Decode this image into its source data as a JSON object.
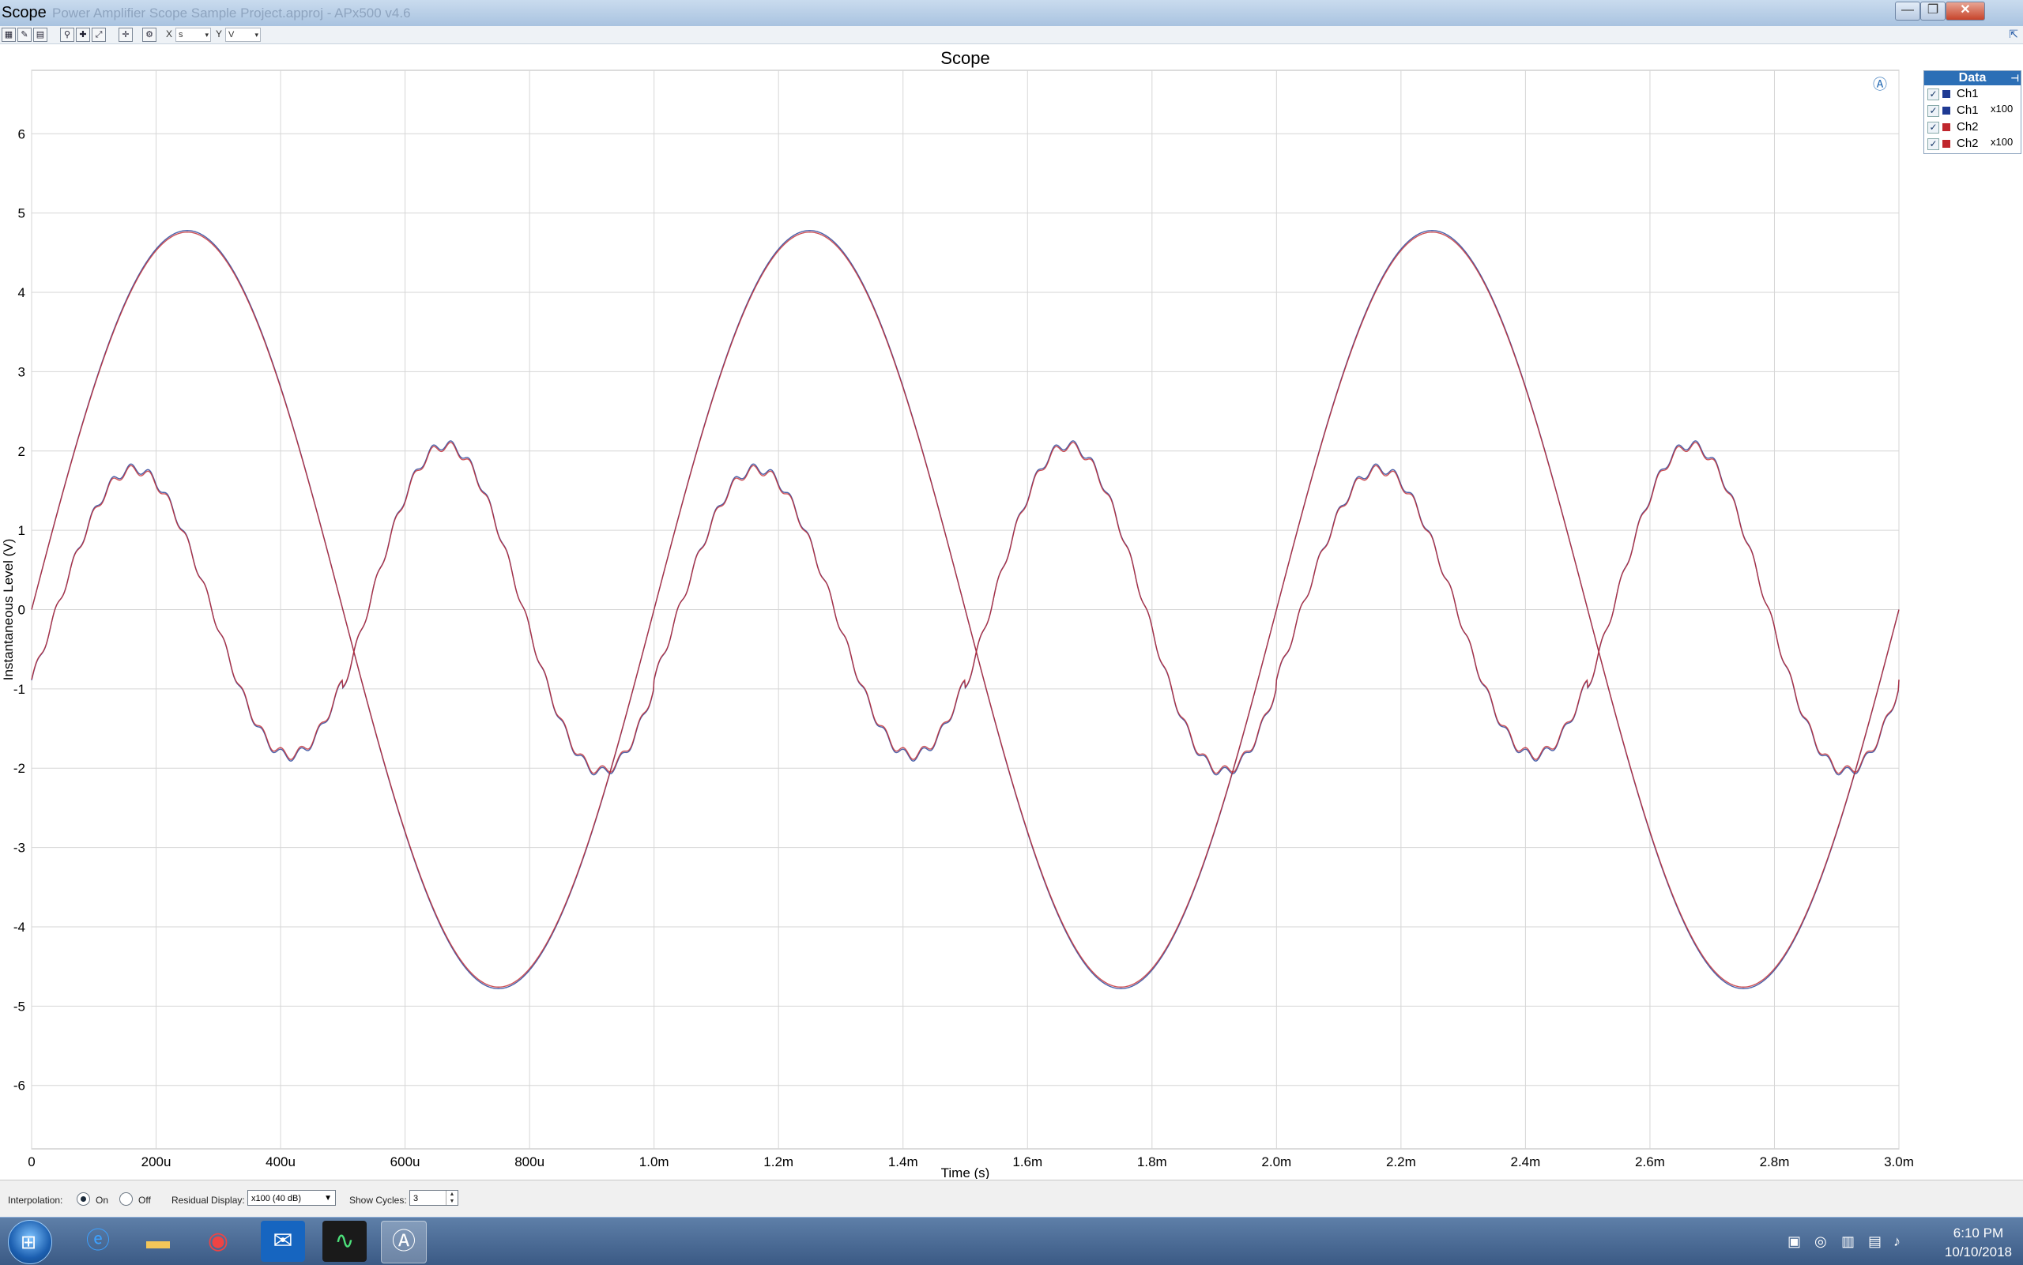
{
  "window": {
    "title": "Scope",
    "app_title": "Power Amplifier Scope Sample Project.approj - APx500 v4.6",
    "min": "—",
    "max": "❐",
    "close": "✕"
  },
  "toolbar": {
    "x_label": "X",
    "x_unit": "s",
    "y_label": "Y",
    "y_unit": "V"
  },
  "chart_data": {
    "type": "line",
    "title": "Scope",
    "xlabel": "Time (s)",
    "ylabel": "Instantaneous Level (V)",
    "xlim": [
      0,
      0.003
    ],
    "ylim": [
      -6.8,
      6.8
    ],
    "xticks": [
      0,
      0.0002,
      0.0004,
      0.0006,
      0.0008,
      0.001,
      0.0012,
      0.0014,
      0.0016,
      0.0018,
      0.002,
      0.0022,
      0.0024,
      0.0026,
      0.0028,
      0.003
    ],
    "xtick_labels": [
      "0",
      "200u",
      "400u",
      "600u",
      "800u",
      "1.0m",
      "1.2m",
      "1.4m",
      "1.6m",
      "1.8m",
      "2.0m",
      "2.2m",
      "2.4m",
      "2.6m",
      "2.8m",
      "3.0m"
    ],
    "yticks": [
      -6,
      -5,
      -4,
      -3,
      -2,
      -1,
      0,
      1,
      2,
      3,
      4,
      5,
      6
    ],
    "ytick_labels": [
      "-6",
      "-5",
      "-4",
      "-3",
      "-2",
      "-1",
      "0",
      "1",
      "2",
      "3",
      "4",
      "5",
      "6"
    ],
    "grid": true,
    "legend_position": "right",
    "series": [
      {
        "name": "Ch1",
        "kind": "sine",
        "amplitude": 4.78,
        "frequency_hz": 1000,
        "color": "#1f3a93"
      },
      {
        "name": "Ch1",
        "suffix": "x100",
        "kind": "residual",
        "peaks_pos": [
          1.78,
          2.08
        ],
        "peaks_neg": [
          -1.85,
          -2.05
        ],
        "frequency_hz": 2000,
        "ripple_hz": 33000,
        "color": "#1f3a93"
      },
      {
        "name": "Ch2",
        "kind": "sine",
        "amplitude": 4.76,
        "frequency_hz": 1000,
        "color": "#c0262d"
      },
      {
        "name": "Ch2",
        "suffix": "x100",
        "kind": "residual",
        "peaks_pos": [
          1.76,
          2.06
        ],
        "peaks_neg": [
          -1.83,
          -2.03
        ],
        "frequency_hz": 2000,
        "ripple_hz": 33000,
        "color": "#c0262d"
      }
    ]
  },
  "legend": {
    "title": "Data",
    "pin": "⊣",
    "items": [
      {
        "name": "Ch1",
        "suffix": "",
        "color": "#1f3a93"
      },
      {
        "name": "Ch1",
        "suffix": "x100",
        "color": "#1f3a93"
      },
      {
        "name": "Ch2",
        "suffix": "",
        "color": "#c0262d"
      },
      {
        "name": "Ch2",
        "suffix": "x100",
        "color": "#c0262d"
      }
    ]
  },
  "status": {
    "interpolation_label": "Interpolation:",
    "on_label": "On",
    "off_label": "Off",
    "residual_label": "Residual Display:",
    "residual_value": "x100 (40 dB)",
    "cycles_label": "Show Cycles:",
    "cycles_value": "3"
  },
  "taskbar": {
    "time": "6:10 PM",
    "date": "10/10/2018"
  }
}
